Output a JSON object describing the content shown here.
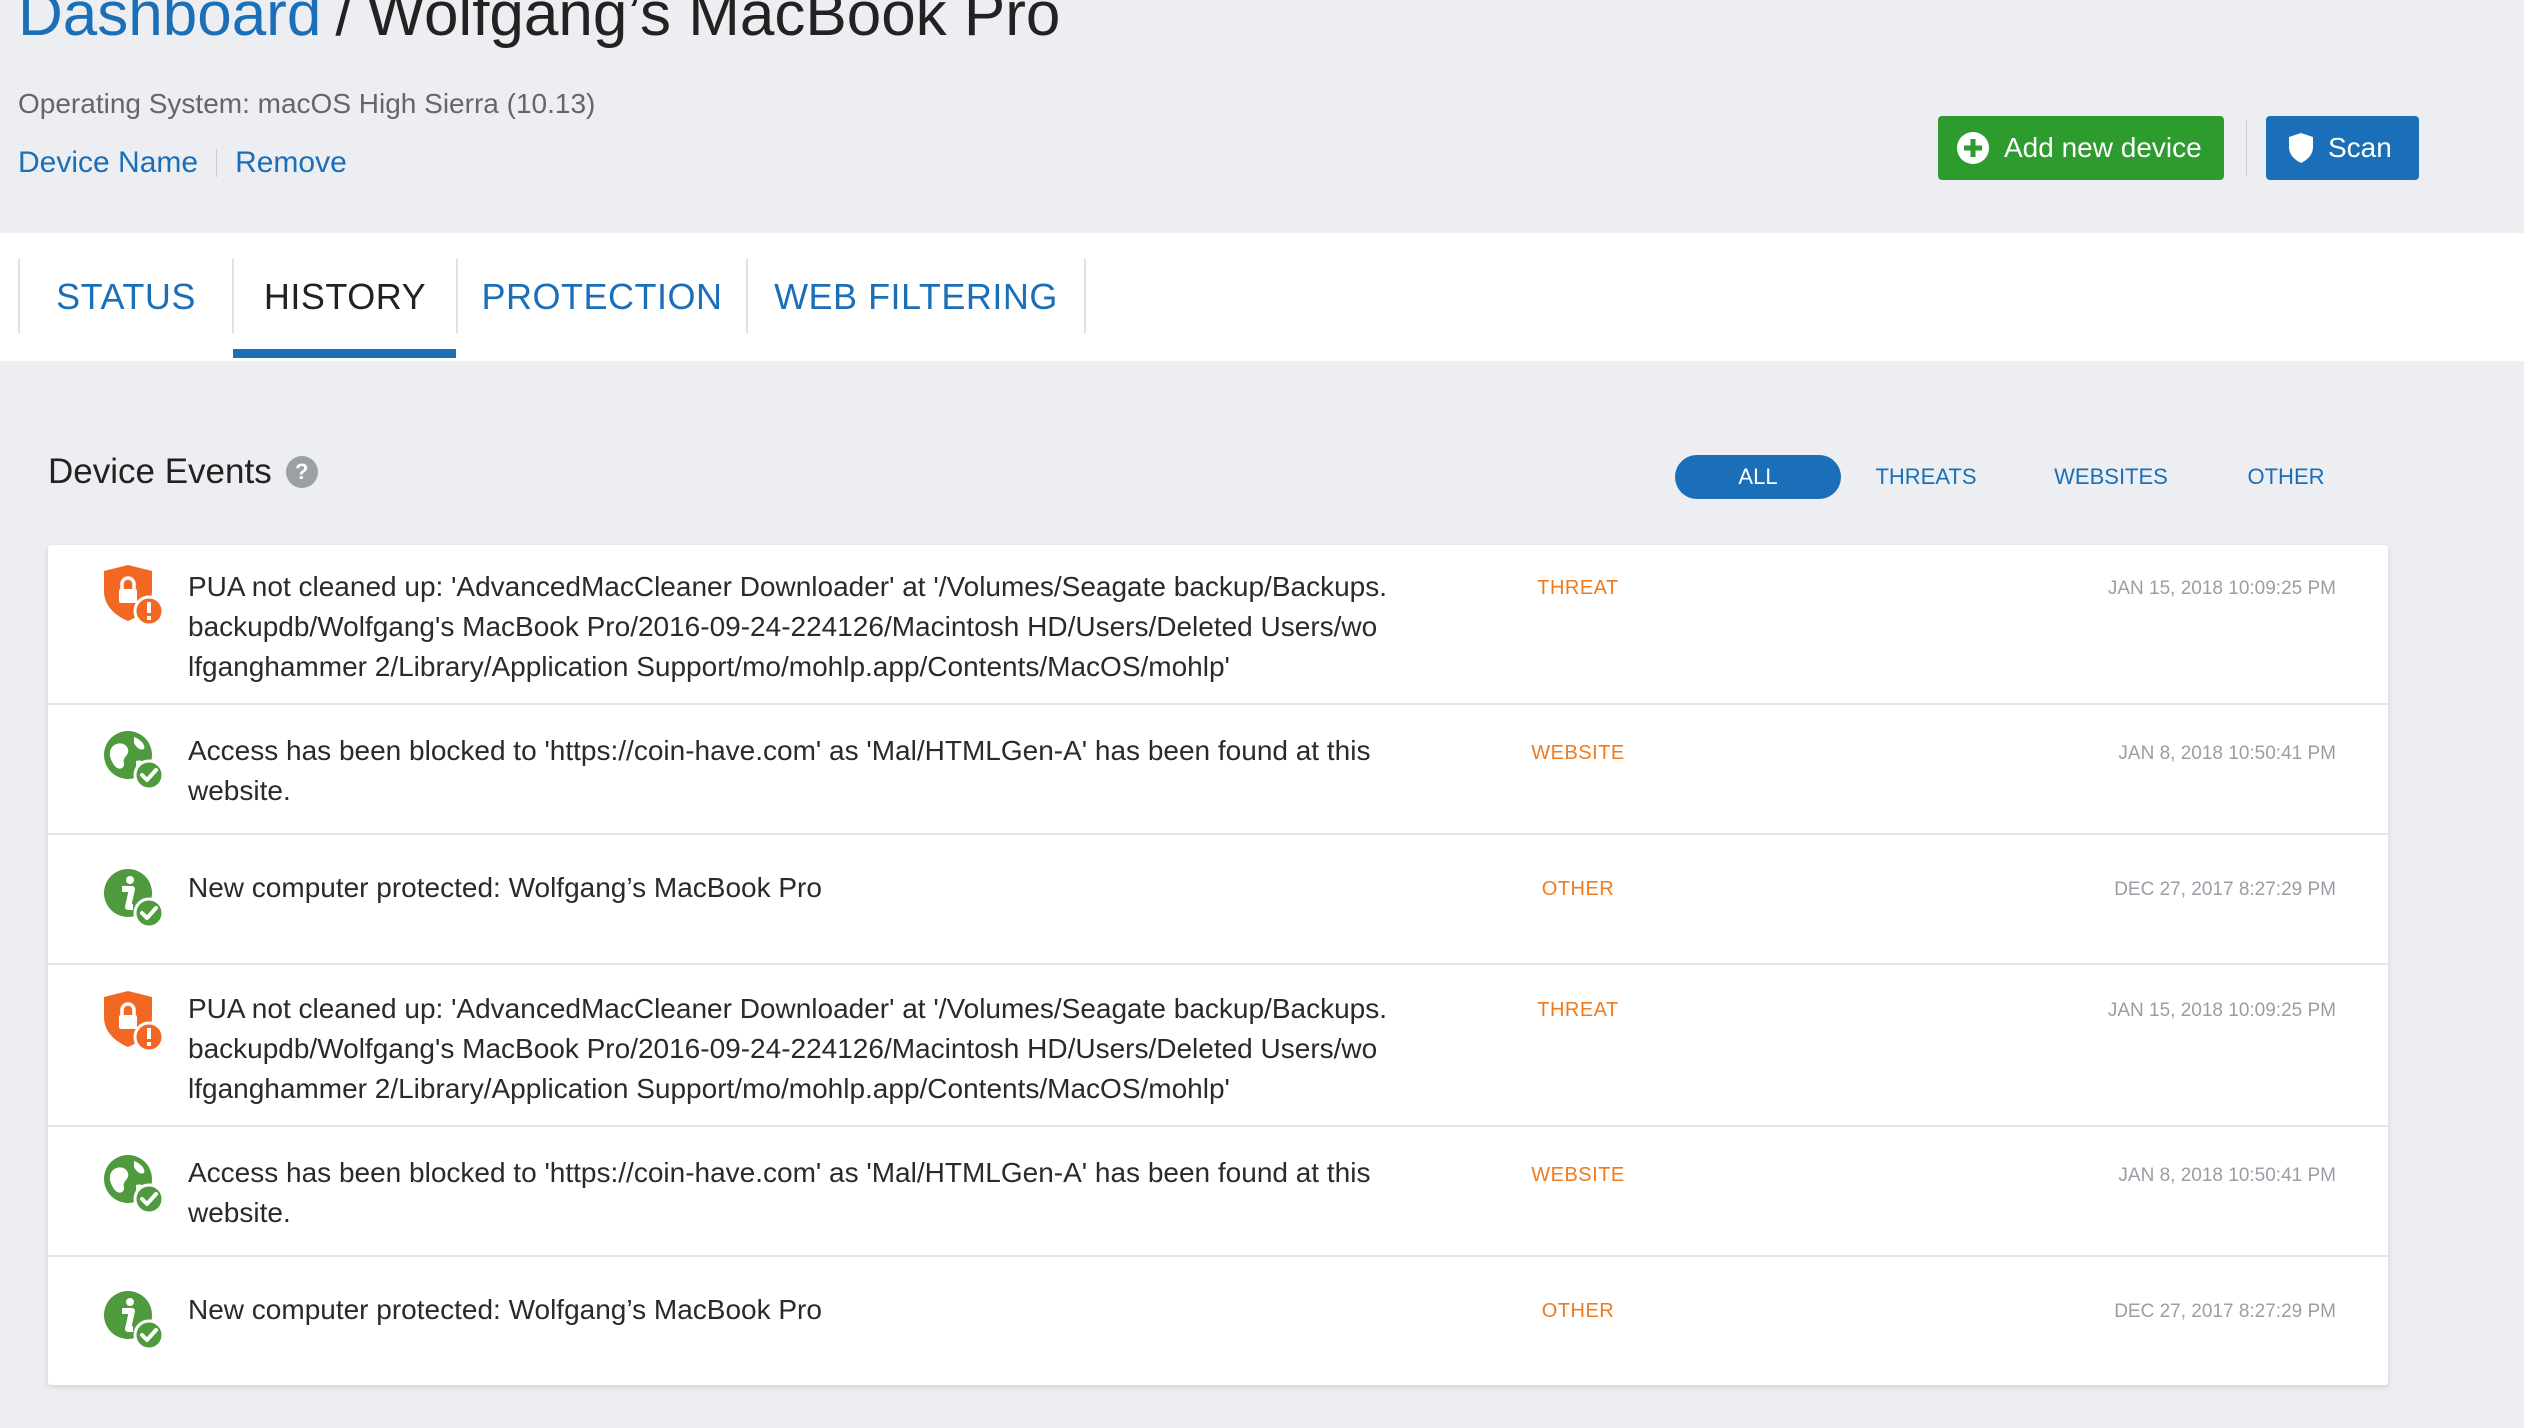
{
  "header": {
    "breadcrumb_root": "Dashboard",
    "separator": "/",
    "device_title": "Wolfgang’s MacBook Pro",
    "os_line": "Operating System: macOS High Sierra (10.13)",
    "links": {
      "device_name": "Device Name",
      "remove": "Remove"
    },
    "buttons": {
      "add_device": "Add new device",
      "scan": "Scan"
    }
  },
  "tabs": [
    {
      "label": "STATUS",
      "active": false
    },
    {
      "label": "HISTORY",
      "active": true
    },
    {
      "label": "PROTECTION",
      "active": false
    },
    {
      "label": "WEB FILTERING",
      "active": false
    }
  ],
  "events": {
    "title": "Device Events",
    "help_icon": "?",
    "filters": [
      {
        "label": "ALL",
        "active": true
      },
      {
        "label": "THREATS",
        "active": false
      },
      {
        "label": "WEBSITES",
        "active": false
      },
      {
        "label": "OTHER",
        "active": false
      }
    ],
    "rows": [
      {
        "icon": "threat-shield-icon",
        "text": "PUA not cleaned up: 'AdvancedMacCleaner Downloader' at '/Volumes/Seagate backup/Backups.backupdb/Wolfgang's MacBook Pro/2016-09-24-224126/Macintosh HD/Users/Deleted Users/wolfganghammer 2/Library/Application Support/mo/mohlp.app/Contents/MacOS/mohlp'",
        "lines": [
          "PUA not cleaned up: 'AdvancedMacCleaner Downloader' at '/Volumes/Seagate backup/Backups.",
          "backupdb/Wolfgang's MacBook Pro/2016-09-24-224126/Macintosh HD/Users/Deleted Users/wo",
          "lfganghammer 2/Library/Application Support/mo/mohlp.app/Contents/MacOS/mohlp'"
        ],
        "type": "THREAT",
        "date": "JAN 15, 2018 10:09:25 PM"
      },
      {
        "icon": "globe-check-icon",
        "lines": [
          "Access has been blocked to 'https://coin-have.com' as 'Mal/HTMLGen-A' has been found at this",
          "website."
        ],
        "type": "WEBSITE",
        "date": "JAN 8, 2018 10:50:41 PM"
      },
      {
        "icon": "info-check-icon",
        "lines": [
          "New computer protected: Wolfgang’s MacBook Pro"
        ],
        "type": "OTHER",
        "date": "DEC 27, 2017 8:27:29 PM"
      },
      {
        "icon": "threat-shield-icon",
        "lines": [
          "PUA not cleaned up: 'AdvancedMacCleaner Downloader' at '/Volumes/Seagate backup/Backups.",
          "backupdb/Wolfgang's MacBook Pro/2016-09-24-224126/Macintosh HD/Users/Deleted Users/wo",
          "lfganghammer 2/Library/Application Support/mo/mohlp.app/Contents/MacOS/mohlp'"
        ],
        "type": "THREAT",
        "date": "JAN 15, 2018 10:09:25 PM"
      },
      {
        "icon": "globe-check-icon",
        "lines": [
          "Access has been blocked to 'https://coin-have.com' as 'Mal/HTMLGen-A' has been found at this",
          "website."
        ],
        "type": "WEBSITE",
        "date": "JAN 8, 2018 10:50:41 PM"
      },
      {
        "icon": "info-check-icon",
        "lines": [
          "New computer protected: Wolfgang’s MacBook Pro"
        ],
        "type": "OTHER",
        "date": "DEC 27, 2017 8:27:29 PM"
      }
    ]
  },
  "colors": {
    "brand_blue": "#1a6fb8",
    "add_green": "#2e9b2f",
    "threat_orange": "#f26722",
    "ok_green": "#4f9a3c",
    "type_orange": "#f07a1c"
  }
}
